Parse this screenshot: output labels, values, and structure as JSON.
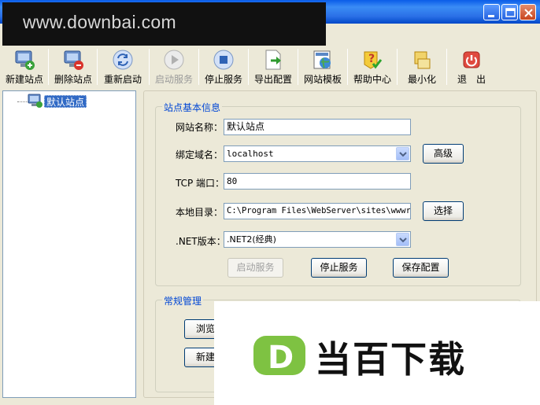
{
  "watermark_top": "www.downbai.com",
  "toolbar": {
    "items": [
      {
        "label": "新建站点",
        "icon": "new-site-icon"
      },
      {
        "label": "删除站点",
        "icon": "delete-site-icon"
      },
      {
        "label": "重新启动",
        "icon": "restart-icon"
      },
      {
        "label": "启动服务",
        "icon": "start-icon",
        "disabled": true
      },
      {
        "label": "停止服务",
        "icon": "stop-icon"
      },
      {
        "label": "导出配置",
        "icon": "export-icon"
      },
      {
        "label": "网站模板",
        "icon": "template-icon"
      },
      {
        "label": "帮助中心",
        "icon": "help-icon"
      },
      {
        "label": "最小化",
        "icon": "minimize-icon"
      },
      {
        "label": "退　出",
        "icon": "exit-icon"
      }
    ]
  },
  "tree": {
    "node": "默认站点"
  },
  "site_info": {
    "legend": "站点基本信息",
    "name_label": "网站名称：",
    "name_value": "默认站点",
    "domain_label": "绑定域名：",
    "domain_value": "localhost",
    "advanced_btn": "高级",
    "port_label": "TCP 端口：",
    "port_value": "80",
    "dir_label": "本地目录：",
    "dir_value": "C:\\Program Files\\WebServer\\sites\\wwwroot",
    "browse_btn": "选择",
    "net_label": ".NET版本：",
    "net_value": ".NET2(经典)",
    "start_btn": "启动服务",
    "stop_btn": "停止服务",
    "save_btn": "保存配置"
  },
  "general": {
    "legend": "常规管理",
    "browse_btn": "浏览",
    "new_btn": "新建"
  },
  "watermark_bottom": {
    "logo": "D",
    "text": "当百下载"
  },
  "colors": {
    "selection": "#316ac5",
    "legend": "#0046d5",
    "logo": "#7ec242"
  }
}
